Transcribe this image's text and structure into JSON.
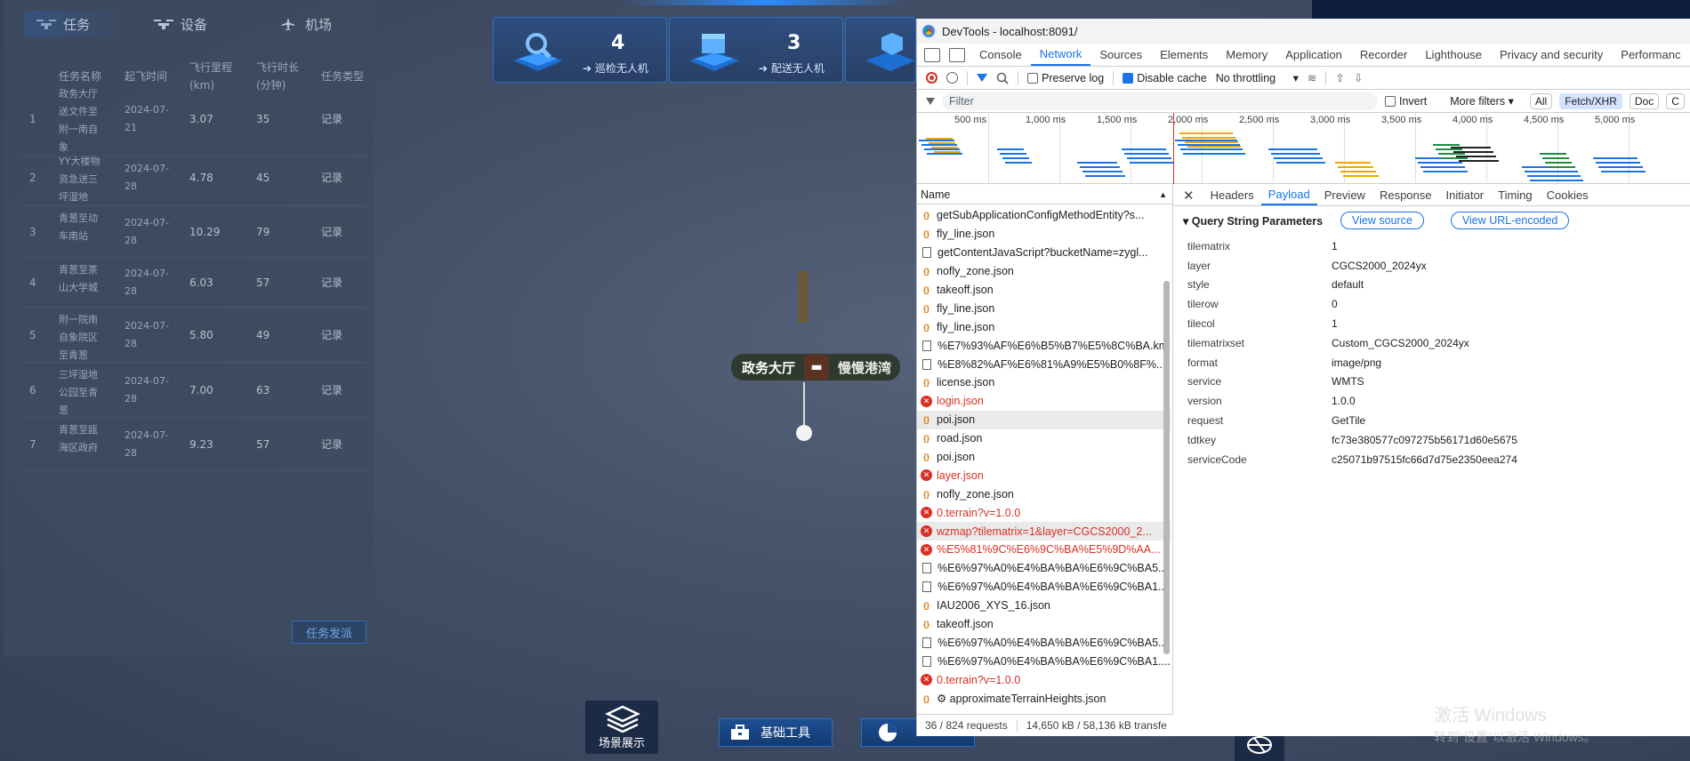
{
  "left_panel": {
    "tabs": [
      {
        "label": "任务",
        "icon": "drone-icon"
      },
      {
        "label": "设备",
        "icon": "drone-icon"
      },
      {
        "label": "机场",
        "icon": "plane-icon"
      }
    ],
    "columns": [
      "任务名称",
      "起飞时间",
      "飞行里程(km)",
      "飞行时长(分钟)",
      "任务类型"
    ],
    "rows": [
      {
        "idx": "1",
        "name": "政务大厅送文件至附一南自象",
        "time": "2024-07-21",
        "km": "3.07",
        "min": "35",
        "type": "记录"
      },
      {
        "idx": "2",
        "name": "YY大楼物资急送三坪湿地",
        "time": "2024-07-28",
        "km": "4.78",
        "min": "45",
        "type": "记录"
      },
      {
        "idx": "3",
        "name": "青葱至动车南站",
        "time": "2024-07-28",
        "km": "10.29",
        "min": "79",
        "type": "记录"
      },
      {
        "idx": "4",
        "name": "青葱至茶山大学城",
        "time": "2024-07-28",
        "km": "6.03",
        "min": "57",
        "type": "记录"
      },
      {
        "idx": "5",
        "name": "附一院南自象院区至青葱",
        "time": "2024-07-28",
        "km": "5.80",
        "min": "49",
        "type": "记录"
      },
      {
        "idx": "6",
        "name": "三坪湿地公园至青葱",
        "time": "2024-07-28",
        "km": "7.00",
        "min": "63",
        "type": "记录"
      },
      {
        "idx": "7",
        "name": "青葱至瓯海区政府",
        "time": "2024-07-28",
        "km": "9.23",
        "min": "57",
        "type": "记录"
      }
    ],
    "send_button": "任务发派"
  },
  "stat_cards": [
    {
      "value": "4",
      "label": "巡检无人机",
      "icon": "search-icon"
    },
    {
      "value": "3",
      "label": "配送无人机",
      "icon": "box-icon"
    }
  ],
  "map": {
    "marker_label": "政务大厅",
    "marker_label2": "慢慢港湾",
    "marker_icon": "bed-icon"
  },
  "bottom_toolbar": {
    "scene": "场景展示",
    "tools": "基础工具",
    "scene_icon": "layers-icon",
    "tools_icon": "toolbox-icon",
    "chart_icon": "pie-chart-icon"
  },
  "devtools": {
    "title": "DevTools - localhost:8091/",
    "tabs": [
      "Console",
      "Network",
      "Sources",
      "Elements",
      "Memory",
      "Application",
      "Recorder",
      "Lighthouse",
      "Privacy and security",
      "Performanc"
    ],
    "active_tab": "Network",
    "toolbar": {
      "preserve_log": "Preserve log",
      "disable_cache": "Disable cache",
      "throttling": "No throttling"
    },
    "filter": {
      "placeholder": "Filter",
      "invert": "Invert",
      "more_filters": "More filters",
      "types": [
        "All",
        "Fetch/XHR",
        "Doc",
        "C"
      ]
    },
    "overview_ticks": [
      "500 ms",
      "1,000 ms",
      "1,500 ms",
      "2,000 ms",
      "2,500 ms",
      "3,000 ms",
      "3,500 ms",
      "4,000 ms",
      "4,500 ms",
      "5,000 ms"
    ],
    "name_header": "Name",
    "requests": [
      {
        "name": "getSubApplicationConfigMethodEntity?s...",
        "type": "xhr",
        "err": false
      },
      {
        "name": "fly_line.json",
        "type": "xhr",
        "err": false
      },
      {
        "name": "getContentJavaScript?bucketName=zygl...",
        "type": "doc",
        "err": false
      },
      {
        "name": "nofly_zone.json",
        "type": "xhr",
        "err": false
      },
      {
        "name": "takeoff.json",
        "type": "xhr",
        "err": false
      },
      {
        "name": "fly_line.json",
        "type": "xhr",
        "err": false
      },
      {
        "name": "fly_line.json",
        "type": "xhr",
        "err": false
      },
      {
        "name": "%E7%93%AF%E6%B5%B7%E5%8C%BA.kml",
        "type": "doc",
        "err": false
      },
      {
        "name": "%E8%82%AF%E6%81%A9%E5%B0%8F%...",
        "type": "doc",
        "err": false
      },
      {
        "name": "license.json",
        "type": "xhr",
        "err": false
      },
      {
        "name": "login.json",
        "type": "err",
        "err": true
      },
      {
        "name": "poi.json",
        "type": "xhr",
        "err": false,
        "sel": true
      },
      {
        "name": "road.json",
        "type": "xhr",
        "err": false
      },
      {
        "name": "poi.json",
        "type": "xhr",
        "err": false
      },
      {
        "name": "layer.json",
        "type": "err",
        "err": true
      },
      {
        "name": "nofly_zone.json",
        "type": "xhr",
        "err": false
      },
      {
        "name": "0.terrain?v=1.0.0",
        "type": "err",
        "err": true
      },
      {
        "name": "wzmap?tilematrix=1&layer=CGCS2000_2...",
        "type": "err",
        "err": true,
        "sel": true
      },
      {
        "name": "%E5%81%9C%E6%9C%BA%E5%9D%AA...",
        "type": "err",
        "err": true
      },
      {
        "name": "%E6%97%A0%E4%BA%BA%E6%9C%BA5....",
        "type": "doc",
        "err": false
      },
      {
        "name": "%E6%97%A0%E4%BA%BA%E6%9C%BA1....",
        "type": "doc",
        "err": false
      },
      {
        "name": "IAU2006_XYS_16.json",
        "type": "xhr",
        "err": false
      },
      {
        "name": "takeoff.json",
        "type": "xhr",
        "err": false
      },
      {
        "name": "%E6%97%A0%E4%BA%BA%E6%9C%BA5....",
        "type": "doc",
        "err": false
      },
      {
        "name": "%E6%97%A0%E4%BA%BA%E6%9C%BA1....",
        "type": "doc",
        "err": false
      },
      {
        "name": "0.terrain?v=1.0.0",
        "type": "err",
        "err": true
      },
      {
        "name": "⚙ approximateTerrainHeights.json",
        "type": "xhr",
        "err": false
      }
    ],
    "status": {
      "requests": "36 / 824 requests",
      "transferred": "14,650 kB / 58,136 kB transfe"
    },
    "detail_tabs": [
      "Headers",
      "Payload",
      "Preview",
      "Response",
      "Initiator",
      "Timing",
      "Cookies"
    ],
    "active_detail_tab": "Payload",
    "qsp": {
      "title": "Query String Parameters",
      "view_source": "View source",
      "view_encoded": "View URL-encoded"
    },
    "params": [
      {
        "k": "tilematrix",
        "v": "1"
      },
      {
        "k": "layer",
        "v": "CGCS2000_2024yx"
      },
      {
        "k": "style",
        "v": "default"
      },
      {
        "k": "tilerow",
        "v": "0"
      },
      {
        "k": "tilecol",
        "v": "1"
      },
      {
        "k": "tilematrixset",
        "v": "Custom_CGCS2000_2024yx"
      },
      {
        "k": "format",
        "v": "image/png"
      },
      {
        "k": "service",
        "v": "WMTS"
      },
      {
        "k": "version",
        "v": "1.0.0"
      },
      {
        "k": "request",
        "v": "GetTile"
      },
      {
        "k": "tdtkey",
        "v": "fc73e380577c097275b56171d60e5675"
      },
      {
        "k": "serviceCode",
        "v": "c25071b97515fc66d7d75e2350eea274"
      }
    ]
  },
  "watermark": {
    "line1": "激活 Windows",
    "line2": "转到\"设置\"以激活 Windows。"
  },
  "colors": {
    "accent": "#1a73e8",
    "error": "#d93025",
    "panel": "#3e4a5e",
    "card_border": "#2b6fc1"
  }
}
